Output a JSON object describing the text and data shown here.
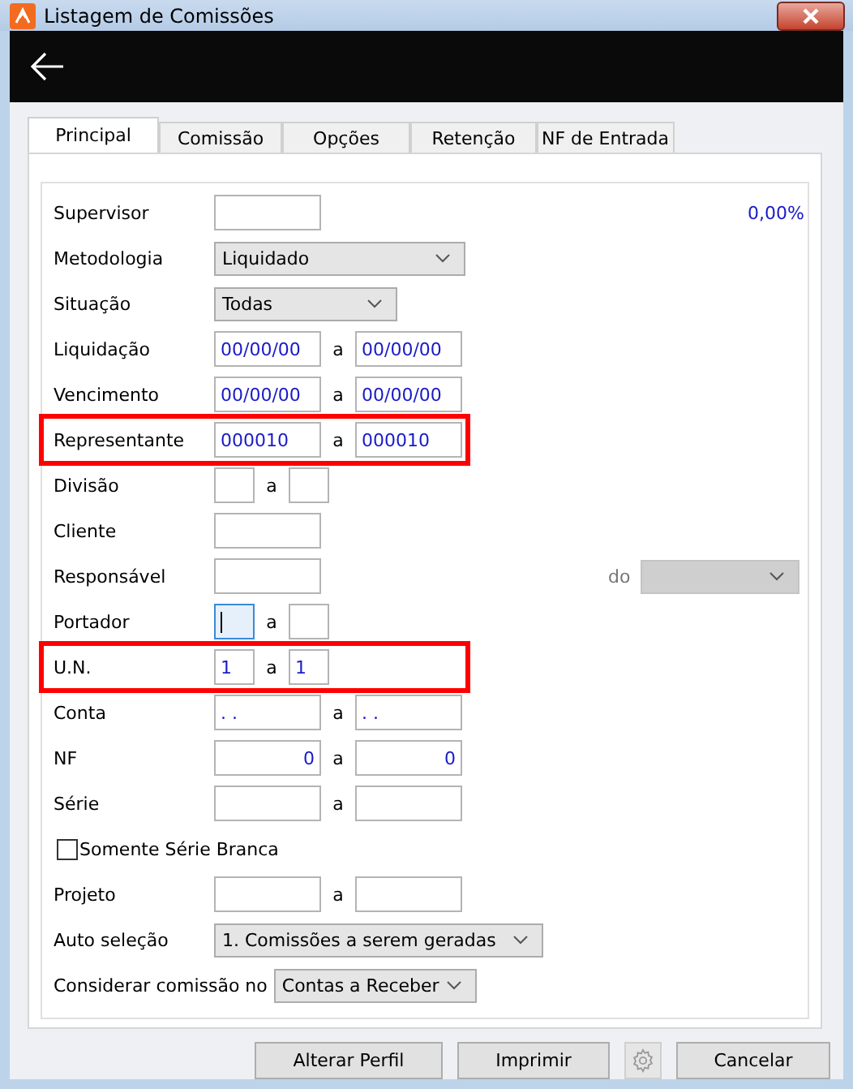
{
  "window": {
    "title": "Listagem de Comissões"
  },
  "tabs": [
    {
      "label": "Principal",
      "selected": true
    },
    {
      "label": "Comissão",
      "selected": false
    },
    {
      "label": "Opções",
      "selected": false
    },
    {
      "label": "Retenção",
      "selected": false
    },
    {
      "label": "NF de Entrada",
      "selected": false
    }
  ],
  "rows": [
    {
      "kind": "text",
      "label": "Supervisor",
      "highlighted": false,
      "aside": {
        "kind": "percent",
        "text": "0,00%"
      }
    },
    {
      "kind": "select",
      "label": "Metodologia",
      "value": "Liquidado",
      "highlighted": false
    },
    {
      "kind": "select",
      "label": "Situação",
      "value": "Todas",
      "highlighted": false
    },
    {
      "kind": "range",
      "label": "Liquidação",
      "separator": "a",
      "from": "00/00/00",
      "to": "00/00/00",
      "highlighted": false
    },
    {
      "kind": "range",
      "label": "Vencimento",
      "separator": "a",
      "from": "00/00/00",
      "to": "00/00/00",
      "highlighted": false
    },
    {
      "kind": "range",
      "label": "Representante",
      "separator": "a",
      "from": "000010",
      "to": "000010",
      "highlighted": true
    },
    {
      "kind": "short_range",
      "label": "Divisão",
      "separator": "a",
      "highlighted": false
    },
    {
      "kind": "text",
      "label": "Cliente",
      "highlighted": false
    },
    {
      "kind": "text",
      "label": "Responsável",
      "highlighted": false,
      "aside": {
        "kind": "dropdown",
        "text": "do",
        "disabled": true
      }
    },
    {
      "kind": "short_range",
      "label": "Portador",
      "separator": "a",
      "highlighted": false,
      "focused": true
    },
    {
      "kind": "short_range",
      "label": "U.N.",
      "separator": "a",
      "from": "1",
      "to": "1",
      "highlighted": true
    },
    {
      "kind": "range",
      "label": "Conta",
      "separator": "a",
      "from": ". .",
      "to": ". .",
      "highlighted": false
    },
    {
      "kind": "number_range",
      "label": "NF",
      "separator": "a",
      "from": "0",
      "to": "0",
      "highlighted": false
    },
    {
      "kind": "range",
      "label": "Série",
      "separator": "a",
      "highlighted": false
    },
    {
      "kind": "checkbox",
      "label": "Somente Série Branca",
      "checked": false
    },
    {
      "kind": "range",
      "label": "Projeto",
      "separator": "a",
      "highlighted": false
    },
    {
      "kind": "select",
      "label": "Auto seleção",
      "value": "1. Comissões a serem geradas",
      "highlighted": false
    },
    {
      "kind": "select",
      "label": "Considerar comissão no",
      "value": "Contas a Receber",
      "highlighted": false
    }
  ],
  "buttons": [
    {
      "kind": "button",
      "label": "Alterar Perfil"
    },
    {
      "kind": "button",
      "label": "Imprimir"
    },
    {
      "kind": "settings"
    },
    {
      "kind": "button",
      "label": "Cancelar"
    }
  ]
}
